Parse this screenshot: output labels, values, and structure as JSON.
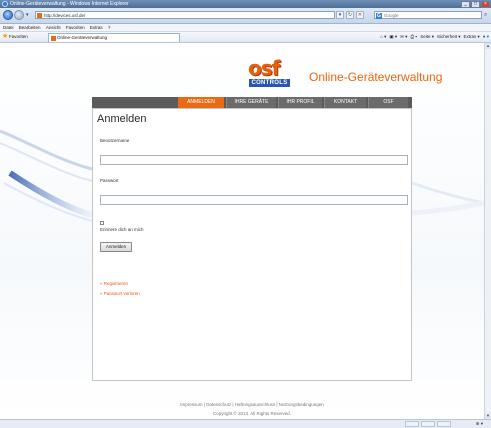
{
  "window": {
    "title": "Online-Geräteverwaltung - Windows Internet Explorer",
    "address": "http://devices.osf.de/",
    "search_placeholder": "Google",
    "search_engine_icon": "google-icon"
  },
  "menu": [
    "Datei",
    "Bearbeiten",
    "Ansicht",
    "Favoriten",
    "Extras",
    "?"
  ],
  "favorites": {
    "label": "Favoriten",
    "tab_title": "Online-Geräteverwaltung"
  },
  "commandbar": [
    "Seite ▾",
    "Sicherheit ▾",
    "Extras ▾"
  ],
  "logo": {
    "main": "osf",
    "sub": "CONTROLS"
  },
  "site_title": "Online-Geräteverwaltung",
  "nav": {
    "items": [
      {
        "label": "ANMELDEN",
        "active": true
      },
      {
        "label": "IHRE GERÄTE",
        "active": false
      },
      {
        "label": "IHR PROFIL",
        "active": false
      },
      {
        "label": "KONTAKT",
        "active": false
      },
      {
        "label": "OSF",
        "active": false
      }
    ]
  },
  "login": {
    "heading": "Anmelden",
    "username_label": "Benutzername",
    "username_value": "",
    "password_label": "Passwort",
    "password_value": "",
    "remember_label": "Erinnere dich an mich",
    "remember_checked": false,
    "submit_label": "Anmelden",
    "link_register": "Registrieren",
    "link_forgot": "Passwort verloren"
  },
  "footer": {
    "links": "Impressum | Datenschutz | Haftungsausschluss | Nutzungsbedingungen",
    "copyright": "Copyright © 2013. All Rights Reserved."
  },
  "colors": {
    "accent": "#e96a14",
    "nav_bg": "#5b5b5b",
    "logo_blue": "#2a56b0"
  }
}
